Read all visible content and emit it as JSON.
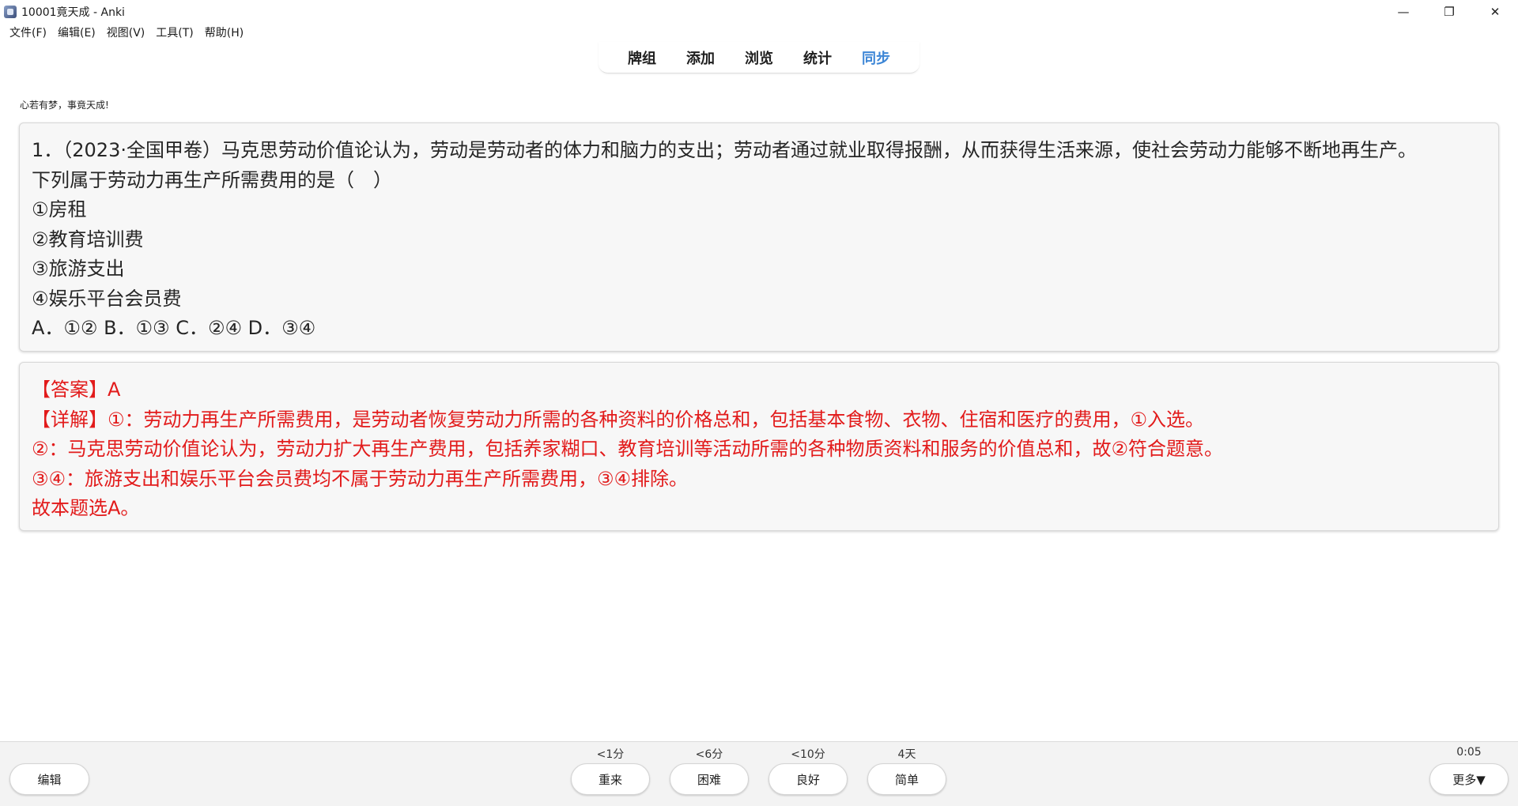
{
  "window": {
    "title": "10001竟天成 - Anki",
    "controls": {
      "minimize": "—",
      "maximize": "❐",
      "close": "✕"
    }
  },
  "menu": [
    "文件(F)",
    "编辑(E)",
    "视图(V)",
    "工具(T)",
    "帮助(H)"
  ],
  "toolbar": {
    "items": [
      "牌组",
      "添加",
      "浏览",
      "统计",
      "同步"
    ],
    "active": "同步"
  },
  "card": {
    "motto": "心若有梦，事竟天成!",
    "question_lines": [
      "1．（2023·全国甲卷）马克思劳动价值论认为，劳动是劳动者的体力和脑力的支出；劳动者通过就业取得报酬，从而获得生活来源，使社会劳动力能够不断地再生产。",
      "下列属于劳动力再生产所需费用的是（　）",
      "①房租",
      "②教育培训费",
      "③旅游支出",
      "④娱乐平台会员费",
      "A．①② B．①③ C．②④ D．③④"
    ],
    "answer_lines": [
      "【答案】A",
      "【详解】①：劳动力再生产所需费用，是劳动者恢复劳动力所需的各种资料的价格总和，包括基本食物、衣物、住宿和医疗的费用，①入选。",
      "②：马克思劳动价值论认为，劳动力扩大再生产费用，包括养家糊口、教育培训等活动所需的各种物质资料和服务的价值总和，故②符合题意。",
      "③④：旅游支出和娱乐平台会员费均不属于劳动力再生产所需费用，③④排除。",
      "故本题选A。"
    ],
    "answer_color": "#e21b1b"
  },
  "bottom": {
    "edit_label": "编辑",
    "more_label": "更多▼",
    "timer": "0:05",
    "answer_buttons": [
      {
        "interval": "<1分",
        "label": "重来"
      },
      {
        "interval": "<6分",
        "label": "困难"
      },
      {
        "interval": "<10分",
        "label": "良好"
      },
      {
        "interval": "4天",
        "label": "简单"
      }
    ]
  },
  "colors": {
    "accent": "#3d86d6",
    "answer_text": "#e21b1b",
    "card_bg": "#f7f7f7"
  }
}
